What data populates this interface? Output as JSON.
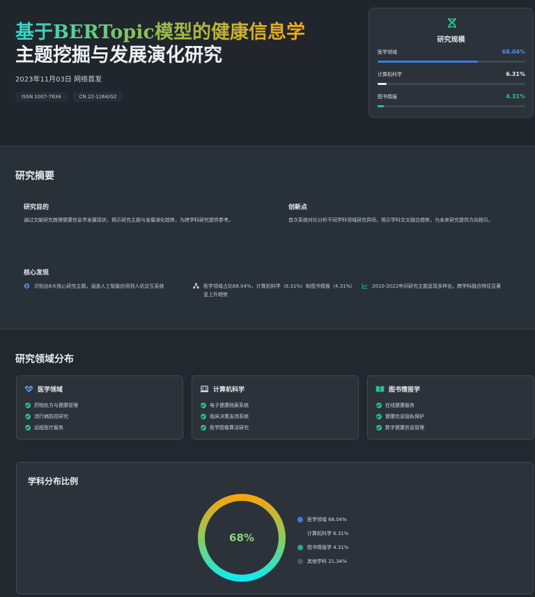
{
  "header": {
    "title_line1": "基于BERTopic模型的健康信息学",
    "title_line2": "主题挖掘与发展演化研究",
    "date": "2023年11月03日 网络首发",
    "tags": [
      "ISSN 1007-7634",
      "CN 22-1264/G2"
    ]
  },
  "scale": {
    "icon": "dna-icon",
    "title": "研究规模",
    "rows": [
      {
        "label": "医学领域",
        "value": "68.04%",
        "percent": 68.04,
        "color": "#4f8ef0"
      },
      {
        "label": "计算机科学",
        "value": "6.31%",
        "percent": 6.31,
        "color": "#e6e9ec"
      },
      {
        "label": "图书情报",
        "value": "4.31%",
        "percent": 4.31,
        "color": "#27c490"
      }
    ]
  },
  "abstract": {
    "title": "研究摘要",
    "purpose_title": "研究目的",
    "purpose_text": "通过文献研究梳理健康信息学发展现状，揭示研究主题与发展演化趋势，为跨学科研究提供参考。",
    "innovation_title": "创新点",
    "innovation_text": "首次系统对比分析不同学科领域研究异同，揭示学科交叉融合趋势，为未来研究提供方向指引。",
    "findings_title": "核心发现",
    "findings": [
      {
        "icon": "brain-icon",
        "text": "识别出6大核心研究主题，涵盖人工智能应用到人机交互系统"
      },
      {
        "icon": "sitemap-icon",
        "text": "医学领域占比68.04%，计算机科学（6.31%）和图书情报（4.31%）呈上升趋势"
      },
      {
        "icon": "trend-chart-icon",
        "text": "2010-2022年间研究主题呈现多样化，跨学科融合特征显著"
      }
    ]
  },
  "domains": {
    "title": "研究领域分布",
    "cards": [
      {
        "icon": "heartbeat-icon",
        "title": "医学领域",
        "items": [
          "药物处方与健康管理",
          "流行病防控研究",
          "远程医疗服务"
        ]
      },
      {
        "icon": "laptop-code-icon",
        "title": "计算机科学",
        "items": [
          "电子健康档案系统",
          "临床决策支持系统",
          "医学图像算法研究"
        ]
      },
      {
        "icon": "book-open-icon",
        "title": "图书情报学",
        "items": [
          "在线健康服务",
          "健康信息隐私保护",
          "数字健康信息管理"
        ]
      }
    ]
  },
  "chart": {
    "title": "学科分布比例",
    "center_label": "68%"
  },
  "chart_data": {
    "type": "pie",
    "title": "学科分布比例",
    "categories": [
      "医学领域",
      "计算机科学",
      "图书情报学",
      "其他学科"
    ],
    "values": [
      68.04,
      6.31,
      4.31,
      21.34
    ],
    "legend_labels": [
      "医学领域 68.04%",
      "计算机科学 6.31%",
      "图书情报学 4.31%",
      "其他学科 21.34%"
    ],
    "legend_colors": [
      "#3c7ce6",
      "#2b3239",
      "#1fae86",
      "#4b5563"
    ],
    "legend_position": "right"
  }
}
